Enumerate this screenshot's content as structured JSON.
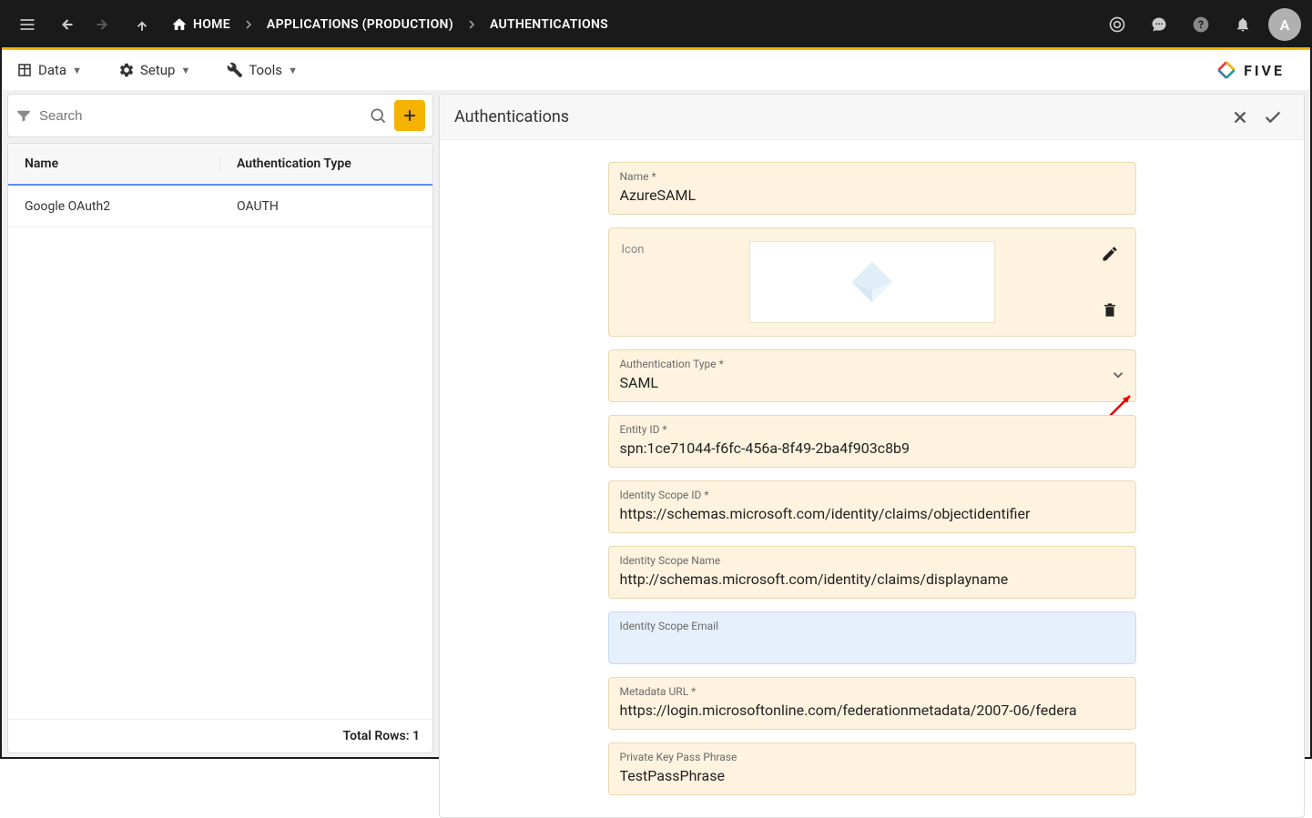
{
  "breadcrumbs": [
    "HOME",
    "APPLICATIONS (PRODUCTION)",
    "AUTHENTICATIONS"
  ],
  "avatar": "A",
  "menu": {
    "data": "Data",
    "setup": "Setup",
    "tools": "Tools"
  },
  "brand": "FIVE",
  "left": {
    "search_placeholder": "Search",
    "columns": {
      "name": "Name",
      "type": "Authentication Type"
    },
    "rows": [
      {
        "name": "Google OAuth2",
        "type": "OAUTH"
      }
    ],
    "total_label": "Total Rows: 1"
  },
  "detail": {
    "title": "Authentications",
    "fields": {
      "name": {
        "label": "Name *",
        "value": "AzureSAML"
      },
      "icon": {
        "label": "Icon"
      },
      "auth_type": {
        "label": "Authentication Type *",
        "value": "SAML"
      },
      "entity_id": {
        "label": "Entity ID *",
        "value": "spn:1ce71044-f6fc-456a-8f49-2ba4f903c8b9"
      },
      "scope_id": {
        "label": "Identity Scope ID *",
        "value": "https://schemas.microsoft.com/identity/claims/objectidentifier"
      },
      "scope_name": {
        "label": "Identity Scope Name",
        "value": "http://schemas.microsoft.com/identity/claims/displayname"
      },
      "scope_email": {
        "label": "Identity Scope Email",
        "value": ""
      },
      "metadata": {
        "label": "Metadata URL *",
        "value": "https://login.microsoftonline.com/federationmetadata/2007-06/federa"
      },
      "passphrase": {
        "label": "Private Key Pass Phrase",
        "value": "TestPassPhrase"
      }
    }
  }
}
